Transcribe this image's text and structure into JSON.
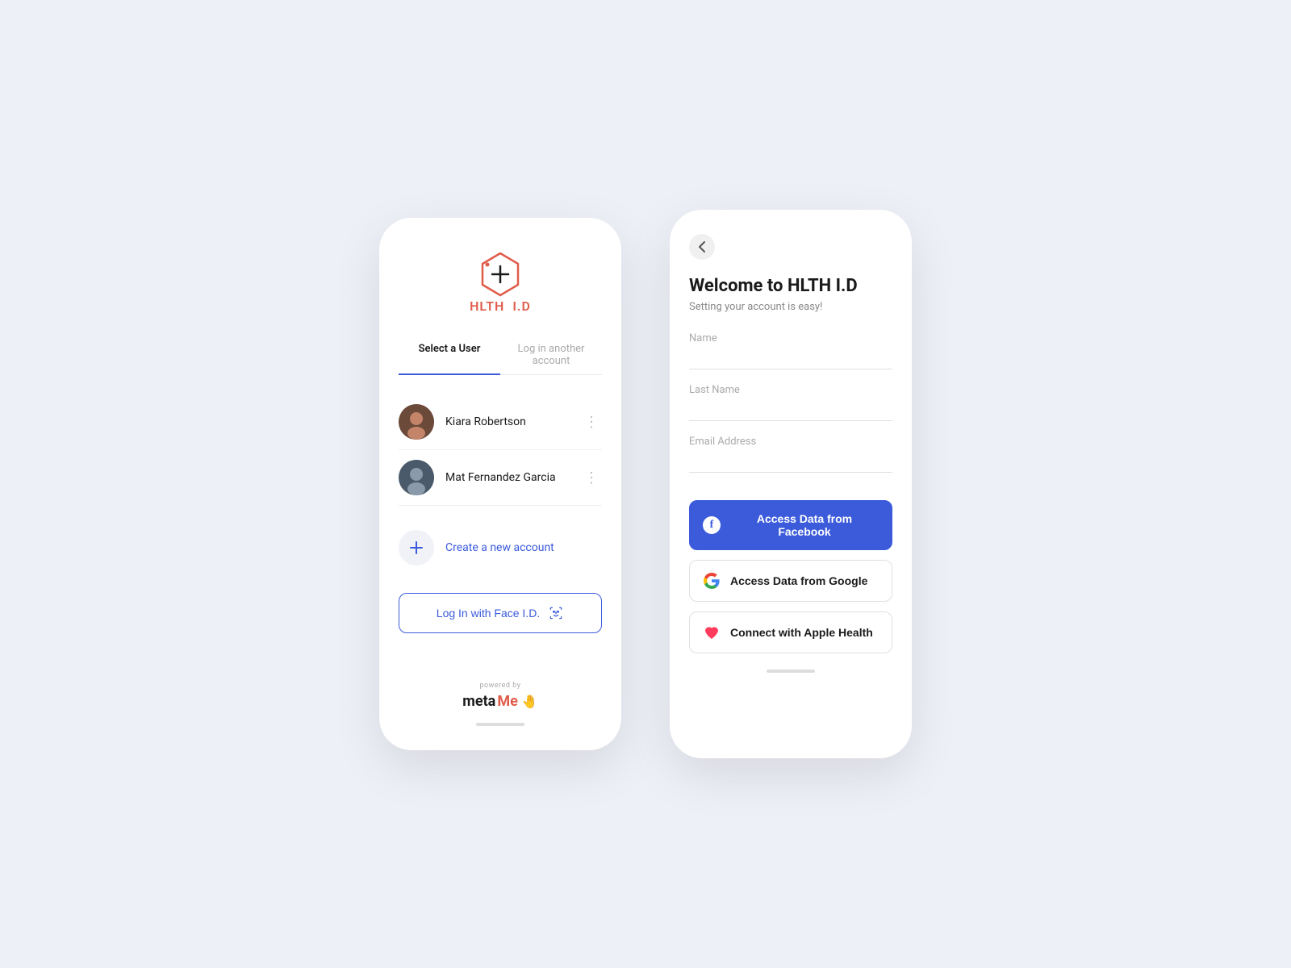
{
  "left_phone": {
    "logo_text_hlth": "HLTH",
    "logo_text_id": "I.D",
    "tabs": [
      {
        "label": "Select a User",
        "active": true
      },
      {
        "label": "Log in another account",
        "active": false
      }
    ],
    "users": [
      {
        "name": "Kiara Robertson",
        "avatar_type": "kiara"
      },
      {
        "name": "Mat Fernandez Garcia",
        "avatar_type": "mat"
      }
    ],
    "create_account_label": "Create a new account",
    "faceid_button_label": "Log In with Face I.D.",
    "powered_by_label": "powered by",
    "metame_meta": "meta",
    "metame_me": "Me"
  },
  "right_phone": {
    "back_icon": "‹",
    "welcome_title": "Welcome to HLTH I.D",
    "welcome_subtitle": "Setting your account is easy!",
    "form_fields": [
      {
        "label": "Name",
        "placeholder": ""
      },
      {
        "label": "Last Name",
        "placeholder": ""
      },
      {
        "label": "Email Address",
        "placeholder": ""
      }
    ],
    "social_buttons": [
      {
        "type": "facebook",
        "label": "Access Data from Facebook"
      },
      {
        "type": "google",
        "label": "Access Data from Google"
      },
      {
        "type": "apple",
        "label": "Connect with Apple Health"
      }
    ]
  }
}
